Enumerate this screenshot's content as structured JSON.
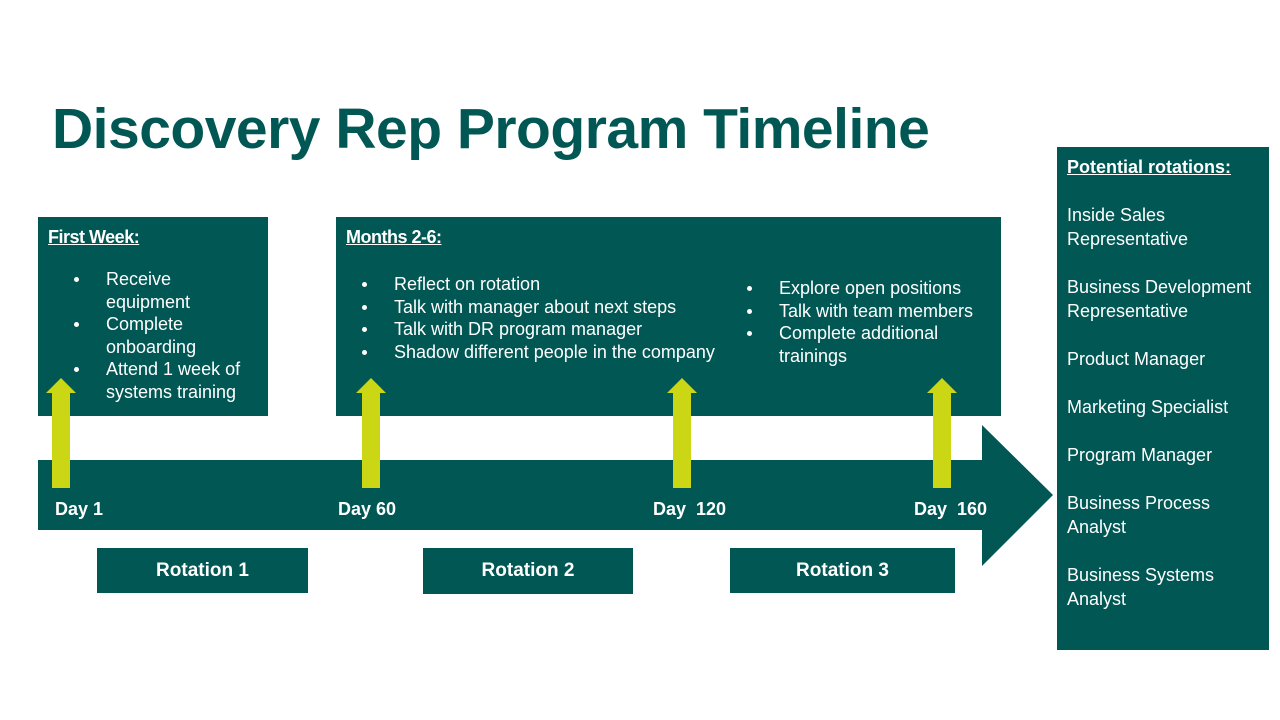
{
  "title": "Discovery Rep Program Timeline",
  "colors": {
    "primary": "#005753",
    "accent": "#cbd614"
  },
  "first_week": {
    "heading": "First Week:",
    "items": [
      "Receive equipment",
      "Complete onboarding",
      "Attend 1 week of systems training"
    ]
  },
  "months": {
    "heading": "Months 2-6:",
    "items_left": [
      "Reflect on rotation",
      "Talk with manager about next steps",
      "Talk with DR program manager",
      "Shadow different people in the company"
    ],
    "items_right": [
      "Explore open positions",
      "Talk with team members",
      "Complete additional trainings"
    ]
  },
  "days": [
    "Day 1",
    "Day 60",
    "Day  120",
    "Day  160"
  ],
  "rotations": [
    "Rotation 1",
    "Rotation 2",
    "Rotation 3"
  ],
  "panel": {
    "heading": "Potential rotations:",
    "items": [
      "Inside Sales Representative",
      "Business Development Representative",
      "Product Manager",
      "Marketing Specialist",
      "Program Manager",
      "Business Process Analyst",
      "Business Systems Analyst"
    ]
  }
}
